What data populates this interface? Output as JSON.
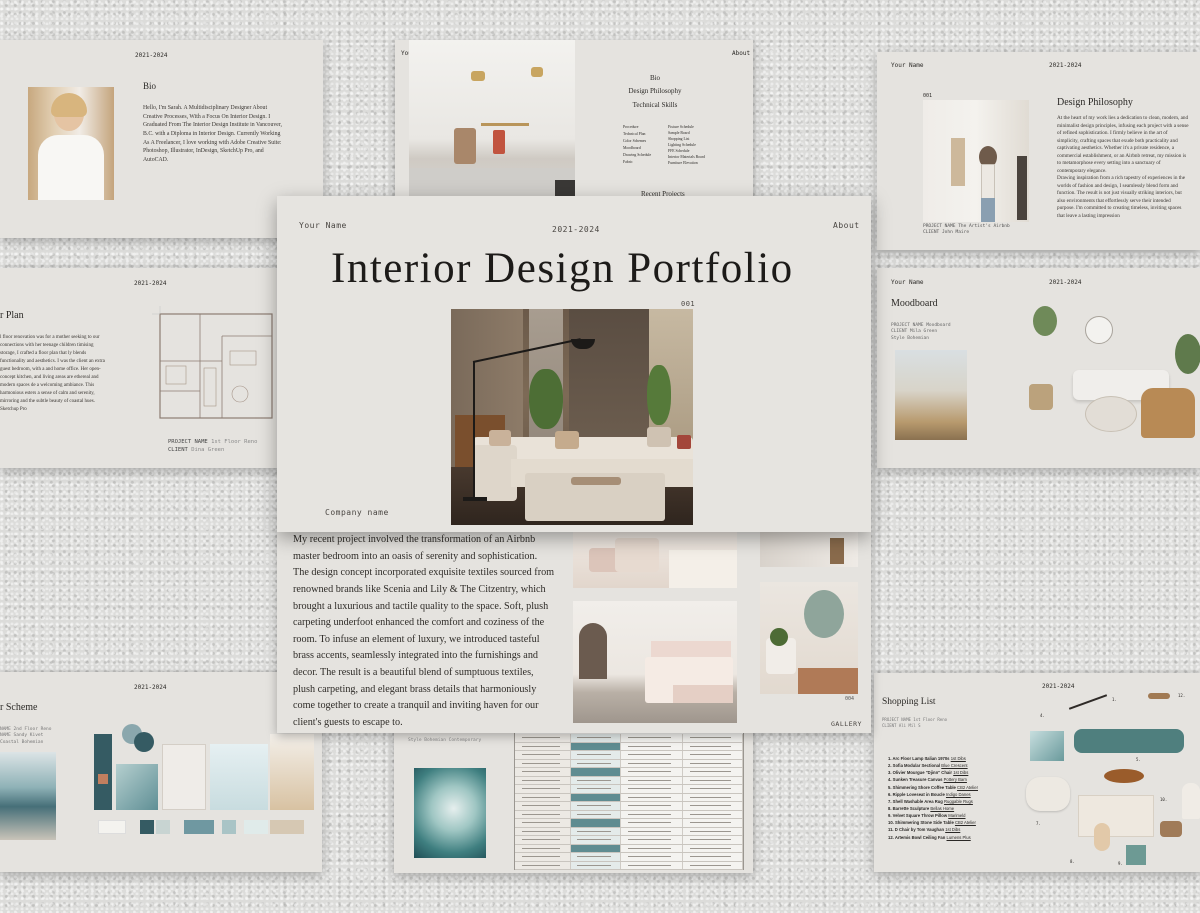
{
  "main": {
    "name": "Your Name",
    "years": "2021-2024",
    "nav": "About",
    "title": "Interior Design Portfolio",
    "page_num": "001",
    "company": "Company name"
  },
  "bio": {
    "years": "2021-2024",
    "heading": "Bio",
    "text": "Hello, I'm Sarah. A Multidisciplinary Designer About Creative Processes, With a Focus On Interior Design. I Graduated From The Interior Design Institute in Vancouver, B.C. with a Diploma in Interior Design. Currently Working As A Freelancer, I love working with Adobe Creative Suite: Photoshop, Illustrator, InDesign, SketchUp Pro, and AutoCAD."
  },
  "contents": {
    "name": "Your Name",
    "nav": "About",
    "items": [
      "Bio",
      "Design Philosophy",
      "Technical Skills"
    ],
    "skills_left": [
      "Procedure",
      "Technical Plan",
      "Color Schemes",
      "Moodboard",
      "Drawing Schedule",
      "Fabric"
    ],
    "skills_right": [
      "Fixture Schedule",
      "Sample Board",
      "Shopping List",
      "Lighting Schedule",
      "FFE Schedule",
      "Interior Materials Board",
      "Furniture Elevation"
    ],
    "recent": "Recent Projects"
  },
  "philosophy": {
    "name": "Your Name",
    "years": "2021-2024",
    "num": "001",
    "heading": "Design Philosophy",
    "text1": "At the heart of my work lies a dedication to clean, modern, and minimalist design principles, infusing each project with a sense of refined sophistication. I firmly believe in the art of simplicity, crafting spaces that exude both practicality and captivating aesthetics. Whether it's a private residence, a commercial establishment, or an Airbnb retreat, my mission is to metamorphose every setting into a sanctuary of contemporary elegance.",
    "text2": "Drawing inspiration from a rich tapestry of experiences in the worlds of fashion and design, I seamlessly blend form and function. The result is not just visually striking interiors, but also environments that effortlessly serve their intended purpose. I'm committed to creating timeless, inviting spaces that leave a lasting impression",
    "project": "PROJECT NAME The Artist's Airbnb",
    "client": "CLIENT John Maire"
  },
  "floorplan": {
    "years": "2021-2024",
    "heading": "r Plan",
    "text": "l floor renovation was for a mother seeking to our connections with her teenage children timising storage, I crafted a floor plan that ly blends functionality and aesthetics. I was the client an extra guest bedroom, with a and home office. Her open-concept kitchen, and living areas are ethereal and modern spaces de a welcoming ambiance. This harmonious esters a sense of calm and serenity, mirroring and the subtle beauty of coastal hues. Sketchup Pro",
    "project_label": "PROJECT NAME",
    "project_value": "1st Floor Reno",
    "client_label": "CLIENT",
    "client_value": "Dina Green"
  },
  "moodboard": {
    "name": "Your Name",
    "years": "2021-2024",
    "heading": "Moodboard",
    "project": "PROJECT NAME Moodboard",
    "client": "CLIENT Mila Green",
    "style": "Style Bohemian"
  },
  "text_slide": {
    "paragraph": "My recent project involved the transformation of an Airbnb master bedroom into an oasis of serenity and sophistication. The design concept incorporated exquisite textiles sourced from renowned brands like Scenia and Lily & The Citzentry, which brought a luxurious and tactile quality to the space. Soft, plush carpeting underfoot enhanced the comfort and coziness of the room. To infuse an element of luxury, we introduced tasteful brass accents, seamlessly integrated into the furnishings and decor. The result is a beautiful blend of sumptuous textiles, plush carpeting, and elegant brass details that harmoniously come together to create a tranquil and inviting haven for our client's guests to escape to.",
    "num": "004",
    "gallery": "GALLERY"
  },
  "colorscheme": {
    "years": "2021-2024",
    "heading": "r Scheme",
    "meta": [
      "NAME 2nd Floor Reno",
      "NAME Sandy Kivet",
      "Coastal Bohemian"
    ],
    "swatches": [
      "#f4f3ef",
      "#355b63",
      "#c8d4d2",
      "#6f98a1",
      "#a9c4c6",
      "#d6c8b3"
    ]
  },
  "schedule": {
    "num": "007",
    "meta": "Style Bohemian Contemporary",
    "rows": 16
  },
  "shopping": {
    "years": "2021-2024",
    "heading": "Shopping List",
    "meta": [
      "PROJECT NAME 1st Floor Reno",
      "CLIENT Ali Mil S"
    ],
    "items": [
      {
        "n": "1. Arc Floor Lamp Italian 1970s",
        "v": "1st Dibs"
      },
      {
        "n": "2. Sofia Modular Sectional",
        "v": "Blue Crescent"
      },
      {
        "n": "3. Olivier Mourgue \"Djinn\" Chair",
        "v": "1st Dibs"
      },
      {
        "n": "4. Sunken Treasure Canvas",
        "v": "Pottery Barn"
      },
      {
        "n": "5. Shimmering Shore Coffee Table",
        "v": "CB2 Atelier"
      },
      {
        "n": "6. Ripple Loveseat in Boucle",
        "v": "Indigo Danes"
      },
      {
        "n": "7. Shell Washable Area Rug",
        "v": "Ruggable Rugs"
      },
      {
        "n": "8. Barrette Sculpture",
        "v": "Bellas Home"
      },
      {
        "n": "9. Velvet Square Throw Pillow",
        "v": "Marimeld"
      },
      {
        "n": "10. Shimmering Stone Side Table",
        "v": "CB2 Atelier"
      },
      {
        "n": "11. D Chair by Tom Vaughan",
        "v": "1st Dibs"
      },
      {
        "n": "12. Artemis Bowl Ceiling Fan",
        "v": "Lumens Plus"
      }
    ],
    "callouts": [
      "1.",
      "2.",
      "3.",
      "4.",
      "5.",
      "6.",
      "7.",
      "8.",
      "9.",
      "10.",
      "11.",
      "12."
    ]
  },
  "colors": {
    "slide_bg": "#e5e3df",
    "wall_bg": "#dcdcda",
    "teal": "#355b63"
  }
}
